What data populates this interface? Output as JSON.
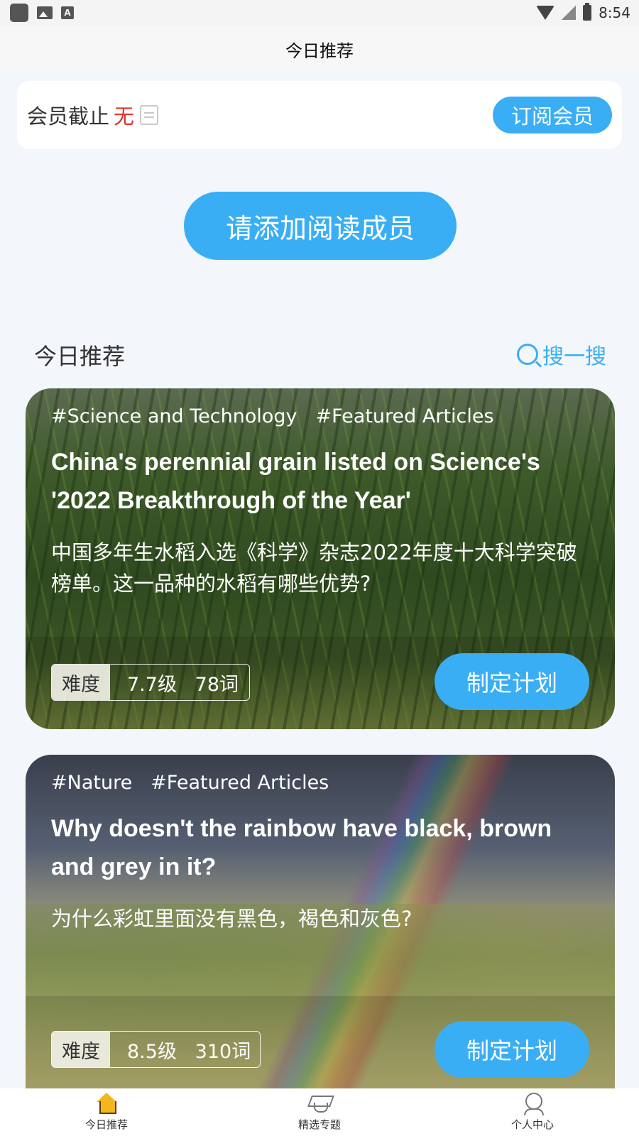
{
  "status_bar": {
    "time": "8:54",
    "icons": [
      "app-icon",
      "image-icon",
      "text-icon",
      "wifi-icon",
      "no-signal-icon",
      "battery-charging-icon"
    ]
  },
  "header": {
    "title": "今日推荐"
  },
  "membership": {
    "label": "会员截止",
    "value": "无",
    "value_color": "#e5332a",
    "subscribe_label": "订阅会员"
  },
  "add_member": {
    "label": "请添加阅读成员"
  },
  "section": {
    "title": "今日推荐",
    "search_label": "搜一搜"
  },
  "articles": [
    {
      "tags": [
        "#Science and Technology",
        "#Featured Articles"
      ],
      "title": "China's perennial grain listed on Science's '2022 Breakthrough of the Year'",
      "description": "中国多年生水稻入选《科学》杂志2022年度十大科学突破榜单。这一品种的水稻有哪些优势?",
      "difficulty_label": "难度",
      "difficulty_value": "7.7级   78词",
      "plan_label": "制定计划"
    },
    {
      "tags": [
        "#Nature",
        "#Featured Articles"
      ],
      "title": "Why doesn't the rainbow have black, brown and grey in it?",
      "description": "为什么彩虹里面没有黑色，褐色和灰色?",
      "difficulty_label": "难度",
      "difficulty_value": "8.5级   310词",
      "plan_label": "制定计划"
    }
  ],
  "bottom_nav": [
    {
      "label": "今日推荐",
      "icon": "home-icon",
      "active": true
    },
    {
      "label": "精选专题",
      "icon": "graduation-cap-icon",
      "active": false
    },
    {
      "label": "个人中心",
      "icon": "user-icon",
      "active": false
    }
  ],
  "colors": {
    "accent": "#3aaef5",
    "background": "#f3f7fc",
    "active_nav_icon": "#f3b61f"
  }
}
